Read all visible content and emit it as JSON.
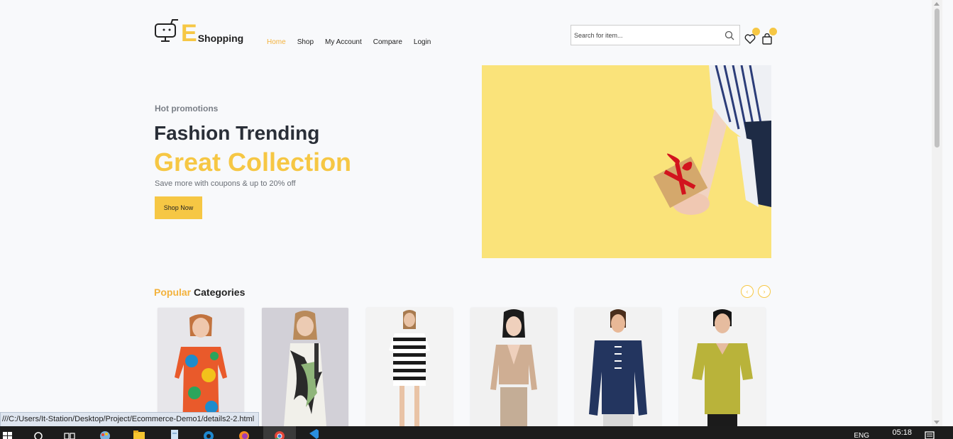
{
  "brand": {
    "letter": "E",
    "name": "Shopping"
  },
  "nav": [
    {
      "label": "Home",
      "active": true
    },
    {
      "label": "Shop",
      "active": false
    },
    {
      "label": "My Account",
      "active": false
    },
    {
      "label": "Compare",
      "active": false
    },
    {
      "label": "Login",
      "active": false
    }
  ],
  "search": {
    "placeholder": "Search for item...",
    "icon": "search-icon"
  },
  "header_icons": {
    "wishlist": {
      "icon": "heart-icon",
      "badge": ""
    },
    "cart": {
      "icon": "shopping-bag-icon",
      "badge": ""
    }
  },
  "hero": {
    "eyebrow": "Hot promotions",
    "title": "Fashion Trending",
    "highlight": "Great Collection",
    "subtitle": "Save more with coupons & up to 20% off",
    "cta": "Shop Now"
  },
  "categories": {
    "title_highlight": "Popular",
    "title_rest": "Categories",
    "prev_icon": "chevron-left-icon",
    "next_icon": "chevron-right-icon",
    "prev_glyph": "‹",
    "next_glyph": "›",
    "items": [
      {
        "name": "floral-dress"
      },
      {
        "name": "palm-print-dress"
      },
      {
        "name": "striped-dress"
      },
      {
        "name": "knit-cardigan-set"
      },
      {
        "name": "denim-jacket"
      },
      {
        "name": "polo-shirt"
      }
    ]
  },
  "status_url": "///C:/Users/It-Station/Desktop/Project/Ecommerce-Demo1/details2-2.html",
  "taskbar": {
    "language": "ENG",
    "time": "05:18"
  },
  "colors": {
    "accent": "#f6c744",
    "accent_text": "#f3b23d",
    "background": "#f8f9fb"
  }
}
